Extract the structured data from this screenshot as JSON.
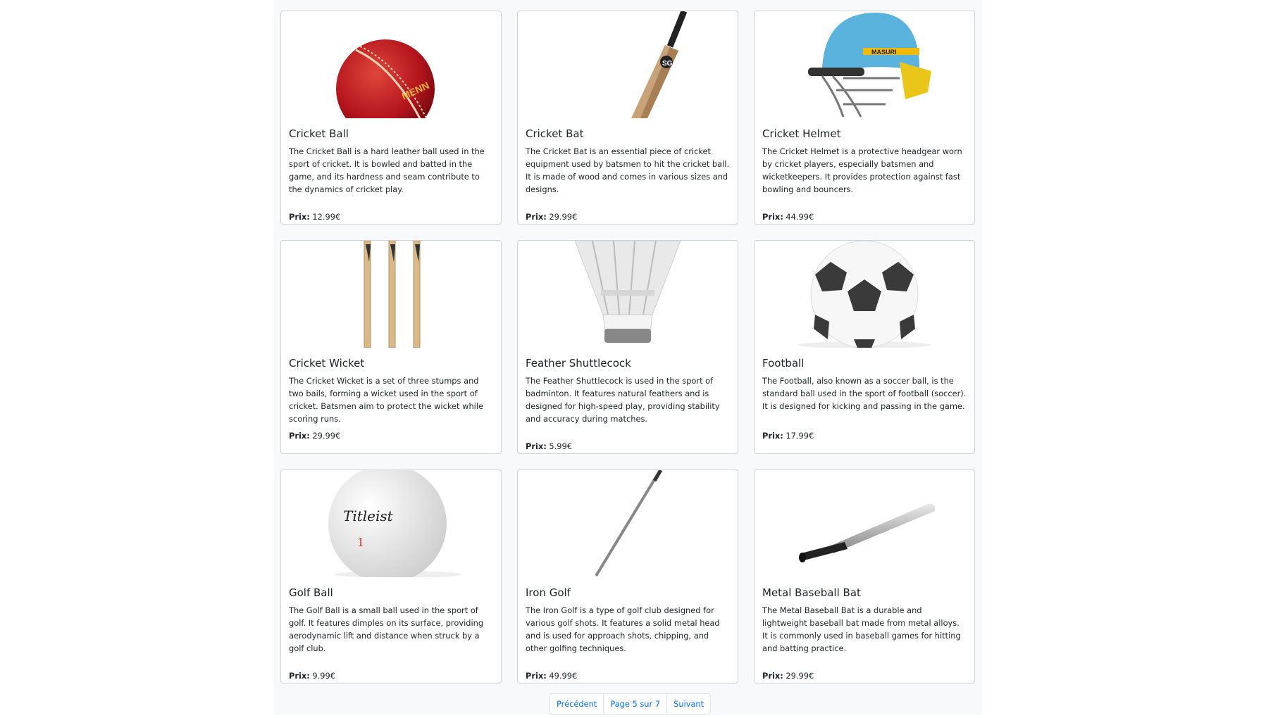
{
  "products": [
    {
      "name": "Cricket Ball",
      "description": "The Cricket Ball is a hard leather ball used in the sport of cricket. It is bowled and batted in the game, and its hardness and seam contribute to the dynamics of cricket play.",
      "price_label": "Prix:",
      "price": "12.99€",
      "image": "cricket-ball"
    },
    {
      "name": "Cricket Bat",
      "description": "The Cricket Bat is an essential piece of cricket equipment used by batsmen to hit the cricket ball. It is made of wood and comes in various sizes and designs.",
      "price_label": "Prix:",
      "price": "29.99€",
      "image": "cricket-bat"
    },
    {
      "name": "Cricket Helmet",
      "description": "The Cricket Helmet is a protective headgear worn by cricket players, especially batsmen and wicketkeepers. It provides protection against fast bowling and bouncers.",
      "price_label": "Prix:",
      "price": "44.99€",
      "image": "cricket-helmet"
    },
    {
      "name": "Cricket Wicket",
      "description": "The Cricket Wicket is a set of three stumps and two bails, forming a wicket used in the sport of cricket. Batsmen aim to protect the wicket while scoring runs.",
      "price_label": "Prix:",
      "price": "29.99€",
      "image": "cricket-wicket"
    },
    {
      "name": "Feather Shuttlecock",
      "description": "The Feather Shuttlecock is used in the sport of badminton. It features natural feathers and is designed for high-speed play, providing stability and accuracy during matches.",
      "price_label": "Prix:",
      "price": "5.99€",
      "image": "shuttlecock"
    },
    {
      "name": "Football",
      "description": "The Football, also known as a soccer ball, is the standard ball used in the sport of football (soccer). It is designed for kicking and passing in the game.",
      "price_label": "Prix:",
      "price": "17.99€",
      "image": "football"
    },
    {
      "name": "Golf Ball",
      "description": "The Golf Ball is a small ball used in the sport of golf. It features dimples on its surface, providing aerodynamic lift and distance when struck by a golf club.",
      "price_label": "Prix:",
      "price": "9.99€",
      "image": "golf-ball"
    },
    {
      "name": "Iron Golf",
      "description": "The Iron Golf is a type of golf club designed for various golf shots. It features a solid metal head and is used for approach shots, chipping, and other golfing techniques.",
      "price_label": "Prix:",
      "price": "49.99€",
      "image": "golf-club"
    },
    {
      "name": "Metal Baseball Bat",
      "description": "The Metal Baseball Bat is a durable and lightweight baseball bat made from metal alloys. It is commonly used in baseball games for hitting and batting practice.",
      "price_label": "Prix:",
      "price": "29.99€",
      "image": "baseball-bat"
    }
  ],
  "image_text": {
    "ball_brand": "MENN",
    "bat_logo": "SG",
    "helmet_brand": "MASURI",
    "golf_brand": "Titleist",
    "golf_number": "1"
  },
  "pagination": {
    "prev": "Précédent",
    "current": "Page 5 sur 7",
    "next": "Suivant"
  }
}
